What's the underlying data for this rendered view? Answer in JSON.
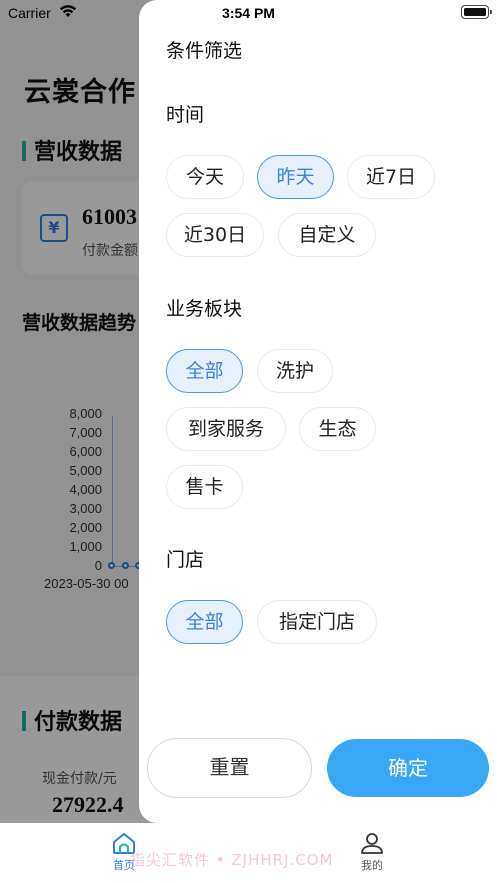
{
  "status_bar": {
    "carrier": "Carrier",
    "time": "3:54 PM"
  },
  "background": {
    "app_title": "云裳合作",
    "revenue_section_title": "营收数据",
    "revenue_card": {
      "amount": "61003",
      "label": "付款金额"
    },
    "trend_title": "营收数据趋势",
    "chart": {
      "y_ticks": [
        "8,000",
        "7,000",
        "6,000",
        "5,000",
        "4,000",
        "3,000",
        "2,000",
        "1,000",
        "0"
      ],
      "x_tick": "2023-05-30 00"
    },
    "payment_section_title": "付款数据",
    "cash_label": "现金付款/元",
    "cash_value": "27922.4"
  },
  "filter": {
    "title": "条件筛选",
    "time": {
      "label": "时间",
      "options": [
        "今天",
        "昨天",
        "近7日",
        "近30日",
        "自定义"
      ],
      "selected": "昨天"
    },
    "business": {
      "label": "业务板块",
      "options": [
        "全部",
        "洗护",
        "到家服务",
        "生态",
        "售卡"
      ],
      "selected": "全部"
    },
    "store": {
      "label": "门店",
      "options": [
        "全部",
        "指定门店"
      ],
      "selected": "全部"
    },
    "reset_label": "重置",
    "confirm_label": "确定",
    "colors": {
      "accent": "#3aa6f6",
      "chip_active_bg": "#e6f1fd",
      "chip_active_border": "#4f95e8"
    }
  },
  "tabbar": {
    "home_label": "首页",
    "mine_label": "我的"
  },
  "watermark": "指尖汇软件 • ZJHHRJ.COM"
}
